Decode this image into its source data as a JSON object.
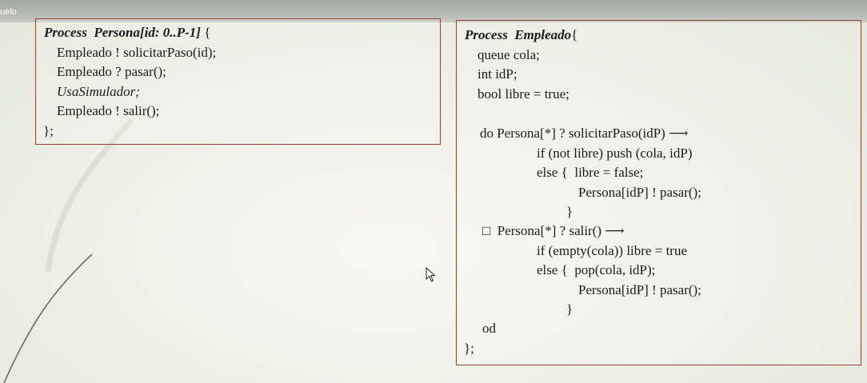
{
  "window": {
    "title_fragment": "uelo"
  },
  "persona_process": {
    "keyword": "Process",
    "name": "Persona[id: 0..P-1]",
    "open_brace": " {",
    "lines": [
      "Empleado ! solicitarPaso(id);",
      "Empleado ? pasar();",
      "UsaSimulador;",
      "Empleado ! salir();"
    ],
    "close": "};"
  },
  "empleado_process": {
    "keyword": "Process",
    "name": "Empleado",
    "open_brace": "{",
    "lines": [
      "queue cola;",
      "int idP;",
      "bool libre = true;",
      "do Persona[*] ? solicitarPaso(idP) ⟶",
      "if (not libre) push (cola, idP)",
      "else {  libre = false;",
      "Persona[idP] ! pasar();",
      "}",
      "□  Persona[*] ? salir() ⟶",
      "if (empty(cola)) libre = true",
      "else {  pop(cola, idP);",
      "Persona[idP] ! pasar();",
      "}",
      "od"
    ],
    "close": "};"
  },
  "icons": {
    "cursor": "mouse-pointer-icon"
  }
}
